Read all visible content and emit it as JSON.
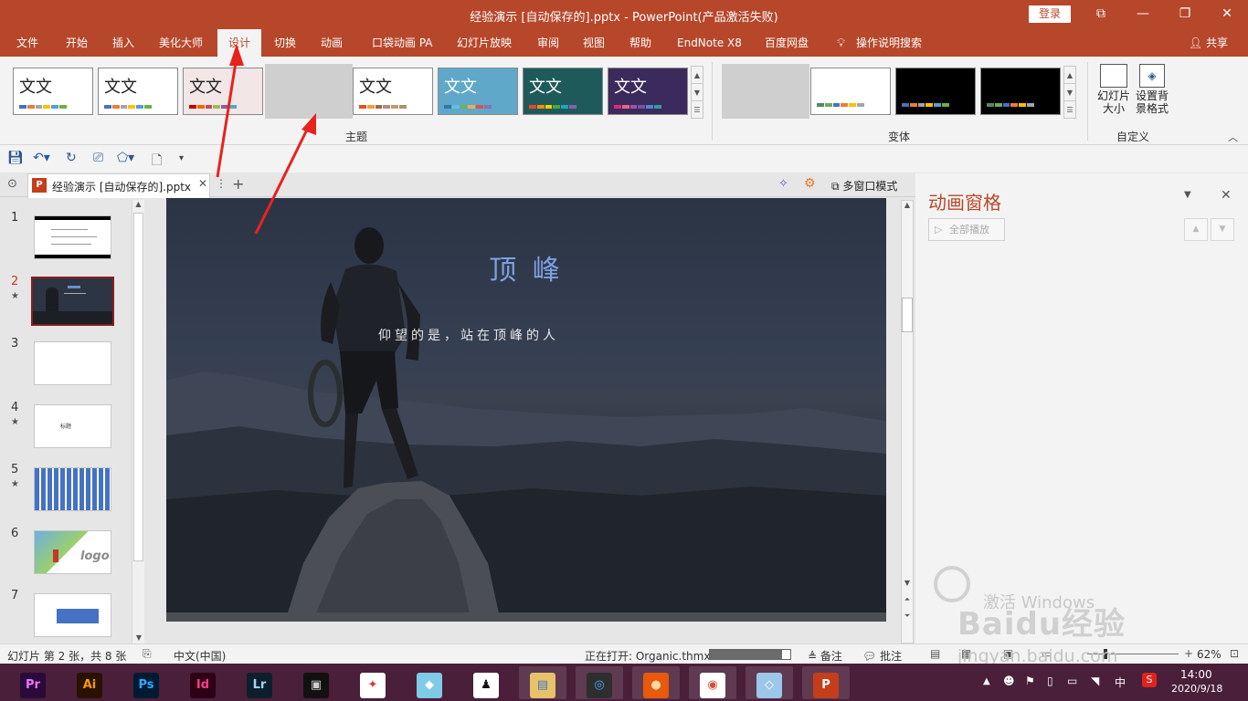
{
  "window": {
    "title": "经验演示 [自动保存的].pptx  -  PowerPoint(产品激活失败)",
    "login": "登录",
    "controls": [
      "⧉",
      "—",
      "❐",
      "✕"
    ]
  },
  "menubar": {
    "tabs": [
      "文件",
      "开始",
      "插入",
      "美化大师",
      "设计",
      "切换",
      "动画",
      "口袋动画 PA",
      "幻灯片放映",
      "审阅",
      "视图",
      "帮助",
      "EndNote X8",
      "百度网盘"
    ],
    "active": "设计",
    "tell_me": "操作说明搜索",
    "share": "共享"
  },
  "ribbon": {
    "themes_label": "主题",
    "variants_label": "变体",
    "customize_label": "自定义",
    "theme_text": "文文",
    "theme_text_alt": "文 文",
    "slide_size": "幻灯片大小",
    "format_background": "设置背景格式",
    "themes": [
      {
        "bg": "#ffffff",
        "colors": [
          "#4472c4",
          "#ed7d31",
          "#a5a5a5",
          "#ffc000",
          "#5b9bd5",
          "#70ad47"
        ]
      },
      {
        "bg": "#ffffff",
        "colors": [
          "#4472c4",
          "#ed7d31",
          "#a5a5a5",
          "#ffc000",
          "#5b9bd5",
          "#70ad47"
        ]
      },
      {
        "bg": "#f2e6e6",
        "colors": [
          "#c00000",
          "#e46c0a",
          "#c0504d",
          "#9bbb59",
          "#8064a2",
          "#4bacc6"
        ]
      },
      {
        "bg": "#e6c89a",
        "colors": [
          "#7f6000",
          "#4a7b3d",
          "#af5a15",
          "#7a5c8f",
          "#2f6b8a",
          "#a02a2a"
        ]
      },
      {
        "bg": "#ffffff",
        "colors": [
          "#e84c22",
          "#f0a22e",
          "#a5644e",
          "#b58b80",
          "#c3986d",
          "#a19574"
        ]
      },
      {
        "bg": "#5fa8c9",
        "colors": [
          "#2e75b6",
          "#5bc0de",
          "#6fb34a",
          "#f0ad4e",
          "#d9534f",
          "#8e6fb0"
        ]
      },
      {
        "bg": "#1f5a5a",
        "colors": [
          "#e64823",
          "#ff8c00",
          "#ffcc00",
          "#4ea72e",
          "#17a8c8",
          "#8b5cb8"
        ]
      },
      {
        "bg": "#3b2a5c",
        "colors": [
          "#e3277b",
          "#ee5f8f",
          "#a154a1",
          "#6e57a8",
          "#4e8ac8",
          "#2d9f9b"
        ]
      }
    ],
    "variants": [
      {
        "bg": "#ffffff",
        "colors": [
          "#4472c4",
          "#ed7d31",
          "#a5a5a5",
          "#ffc000",
          "#5b9bd5",
          "#70ad47"
        ]
      },
      {
        "bg": "#ffffff",
        "colors": [
          "#4e8a6a",
          "#6faa55",
          "#4472c4",
          "#ed7d31",
          "#ffc000",
          "#a5a5a5"
        ]
      },
      {
        "bg": "#000000",
        "colors": [
          "#4472c4",
          "#ed7d31",
          "#a5a5a5",
          "#ffc000",
          "#5b9bd5",
          "#70ad47"
        ]
      },
      {
        "bg": "#000000",
        "colors": [
          "#4e8a6a",
          "#6faa55",
          "#4472c4",
          "#ed7d31",
          "#ffc000",
          "#a5a5a5"
        ]
      }
    ]
  },
  "doc_tab": {
    "name": "经验演示 [自动保存的].pptx",
    "multi_window": "多窗口模式"
  },
  "thumbnails": [
    {
      "num": "1",
      "star": ""
    },
    {
      "num": "2",
      "star": "★",
      "selected": true
    },
    {
      "num": "3",
      "star": ""
    },
    {
      "num": "4",
      "star": "★",
      "label": "标题"
    },
    {
      "num": "5",
      "star": "★"
    },
    {
      "num": "6",
      "star": "",
      "logo": "logo"
    },
    {
      "num": "7",
      "star": ""
    }
  ],
  "slide": {
    "title": "顶 峰",
    "subtitle": "仰望的是，站在顶峰的人"
  },
  "anim_pane": {
    "title": "动画窗格",
    "play_all": "全部播放"
  },
  "statusbar": {
    "slide_info": "幻灯片 第 2 张，共 8 张",
    "language": "中文(中国)",
    "opening": "正在打开: Organic.thmx",
    "notes": "备注",
    "comments": "批注",
    "zoom": "62%",
    "progress": 0.9
  },
  "watermark": {
    "activate": "激活 Windows",
    "site": "jingyan.baidu.com",
    "brand": "Baidu经验"
  },
  "taskbar": {
    "apps": [
      "Pr",
      "Ai",
      "Ps",
      "Id",
      "Lr",
      "▣",
      "✦",
      "◆",
      "♟",
      "▤",
      "◎",
      "●",
      "◉",
      "◇",
      "P"
    ],
    "time": "14:00",
    "date": "2020/9/18",
    "ime": "中"
  },
  "colors": {
    "accent": "#b7472a",
    "arrow": "#e8231c"
  }
}
